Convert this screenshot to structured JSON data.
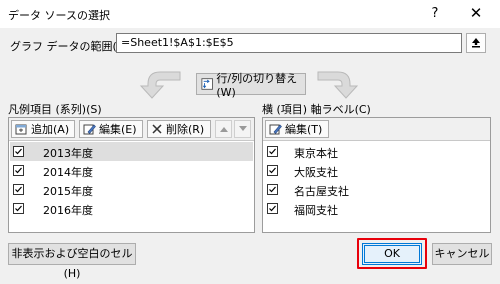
{
  "window": {
    "title": "データ ソースの選択",
    "help_icon": "?",
    "close_icon": "✕"
  },
  "range": {
    "label": "グラフ データの範囲(D):",
    "value": "=Sheet1!$A$1:$E$5"
  },
  "switch_button": {
    "label": "行/列の切り替え(W)"
  },
  "legend": {
    "section_label": "凡例項目 (系列)(S)",
    "add_label": "追加(A)",
    "edit_label": "編集(E)",
    "delete_label": "削除(R)",
    "items": [
      {
        "label": "2013年度",
        "checked": true,
        "selected": true
      },
      {
        "label": "2014年度",
        "checked": true,
        "selected": false
      },
      {
        "label": "2015年度",
        "checked": true,
        "selected": false
      },
      {
        "label": "2016年度",
        "checked": true,
        "selected": false
      }
    ]
  },
  "axis": {
    "section_label": "横 (項目) 軸ラベル(C)",
    "edit_label": "編集(T)",
    "items": [
      {
        "label": "東京本社",
        "checked": true
      },
      {
        "label": "大阪支社",
        "checked": true
      },
      {
        "label": "名古屋支社",
        "checked": true
      },
      {
        "label": "福岡支社",
        "checked": true
      }
    ]
  },
  "footer": {
    "hidden_cells_label": "非表示および空白のセル(H)",
    "ok_label": "OK",
    "cancel_label": "キャンセル"
  },
  "colors": {
    "highlight": "#e8000b",
    "ok_border": "#0078d7",
    "selected_row": "#dedede"
  }
}
